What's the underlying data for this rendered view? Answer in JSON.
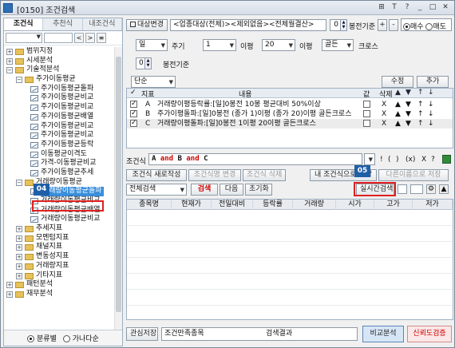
{
  "window": {
    "title": "[0150] 조건검색",
    "buttons": [
      "⊞",
      "T",
      "?",
      "_",
      "□",
      "✕"
    ]
  },
  "left": {
    "tabs": [
      "조건식",
      "추천식",
      "내조건식"
    ],
    "nav_buttons": [
      "<",
      ">",
      "≡"
    ],
    "tree": [
      {
        "label": "범위지정",
        "level": 0,
        "type": "folder"
      },
      {
        "label": "시세분석",
        "level": 0,
        "type": "folder"
      },
      {
        "label": "기술적분석",
        "level": 0,
        "type": "folder-open"
      },
      {
        "label": "주가이동평균",
        "level": 1,
        "type": "folder-open"
      },
      {
        "label": "주가이동평균돌파",
        "level": 2,
        "type": "item"
      },
      {
        "label": "주가이동평균비교",
        "level": 2,
        "type": "item"
      },
      {
        "label": "주가이동평균비교",
        "level": 2,
        "type": "item"
      },
      {
        "label": "주가이동평균배열",
        "level": 2,
        "type": "item"
      },
      {
        "label": "주가이동평균비교",
        "level": 2,
        "type": "item"
      },
      {
        "label": "주가이동평균비교",
        "level": 2,
        "type": "item"
      },
      {
        "label": "주가이동평균등락",
        "level": 2,
        "type": "item"
      },
      {
        "label": "이동평균이격도",
        "level": 2,
        "type": "item"
      },
      {
        "label": "가격-이동평균비교",
        "level": 2,
        "type": "item"
      },
      {
        "label": "주가이동평균추세",
        "level": 2,
        "type": "item"
      },
      {
        "label": "거래량이동평균",
        "level": 1,
        "type": "folder-open"
      },
      {
        "label": "거래량이동평균돌파",
        "level": 2,
        "type": "item",
        "selected": true
      },
      {
        "label": "거래량이동평균비교",
        "level": 2,
        "type": "item"
      },
      {
        "label": "거래량이동평균배열",
        "level": 2,
        "type": "item"
      },
      {
        "label": "거래량이동평균비교",
        "level": 2,
        "type": "item"
      },
      {
        "label": "추세지표",
        "level": 1,
        "type": "folder"
      },
      {
        "label": "모멘텀지표",
        "level": 1,
        "type": "folder"
      },
      {
        "label": "채널지표",
        "level": 1,
        "type": "folder"
      },
      {
        "label": "변동성지표",
        "level": 1,
        "type": "folder"
      },
      {
        "label": "거래량지표",
        "level": 1,
        "type": "folder"
      },
      {
        "label": "기타지표",
        "level": 1,
        "type": "folder"
      },
      {
        "label": "패턴분석",
        "level": 0,
        "type": "folder"
      },
      {
        "label": "재무분석",
        "level": 0,
        "type": "folder"
      }
    ],
    "radios": [
      {
        "label": "분류별",
        "checked": true
      },
      {
        "label": "가나다순",
        "checked": false
      }
    ]
  },
  "top": {
    "target_change": "대상변경",
    "target_desc": "<업종대상(전체)><제외없음><전체월결산>",
    "base_value": "0",
    "base_label": "봉전기준",
    "plus": "+",
    "minus": "-",
    "buy": "매수",
    "sell": "매도"
  },
  "params": {
    "period_select": "일",
    "period_label": "주기",
    "ma1_select": "1",
    "ma1_label": "이평",
    "ma2_select": "20",
    "ma2_label": "이평",
    "type_select": "골든",
    "type_suffix": "크로스",
    "base_value": "0",
    "base_label": "봉전기준",
    "mode_select": "단순",
    "edit_button": "수정",
    "add_button": "추가"
  },
  "conditions": {
    "headers": [
      "✓",
      "지표",
      "내용",
      "값",
      "삭제"
    ],
    "rows": [
      {
        "id": "A",
        "checked": true,
        "content": "거래량이평등락률:[일]0봉전 10봉 평균대비 50%이상",
        "delete": "X"
      },
      {
        "id": "B",
        "checked": true,
        "content": "주가이평돌파:[일]0봉전 (종가 1)이평 (종가 20)이평 골든크로스",
        "delete": "X"
      },
      {
        "id": "C",
        "checked": true,
        "content": "거래량이평돌파:[일]0봉전 1이평 20이평 골든크로스",
        "delete": "X"
      }
    ],
    "arrows": [
      "▲",
      "▼",
      "↑",
      "↓"
    ]
  },
  "formula": {
    "label": "조건식",
    "expression": [
      {
        "t": "A",
        "op": false
      },
      {
        "t": "and",
        "op": true
      },
      {
        "t": "B",
        "op": false
      },
      {
        "t": "and",
        "op": true
      },
      {
        "t": "C",
        "op": false
      }
    ],
    "tools": [
      "!",
      "(",
      ")",
      "(x)",
      "X",
      "?"
    ]
  },
  "actions": {
    "new": "조건식 새로작성",
    "rename": "조건식명 변경",
    "delete": "조건식 삭제",
    "save_mine": "내 조건식으로 저장",
    "save_as": "다른이름으로 저장"
  },
  "search": {
    "scope": "전체검색",
    "search_button": "검색",
    "next_button": "다음",
    "reset_button": "초기화",
    "realtime_button": "실시간검색"
  },
  "annotations": {
    "step4": "04",
    "step5": "05"
  },
  "results": {
    "columns": [
      "종목명",
      "현재가",
      "전일대비",
      "등락률",
      "거래량",
      "시가",
      "고가",
      "저가"
    ],
    "rows": []
  },
  "footer": {
    "interest_button": "관심저장",
    "matched_label": "조건만족종목",
    "result_label": "검색결과",
    "compare_button": "비교분석",
    "reliability_button": "신뢰도검증"
  },
  "colors": {
    "accent": "#1f5fa8",
    "highlight": "#e02020",
    "selected": "#3a8fdd"
  }
}
